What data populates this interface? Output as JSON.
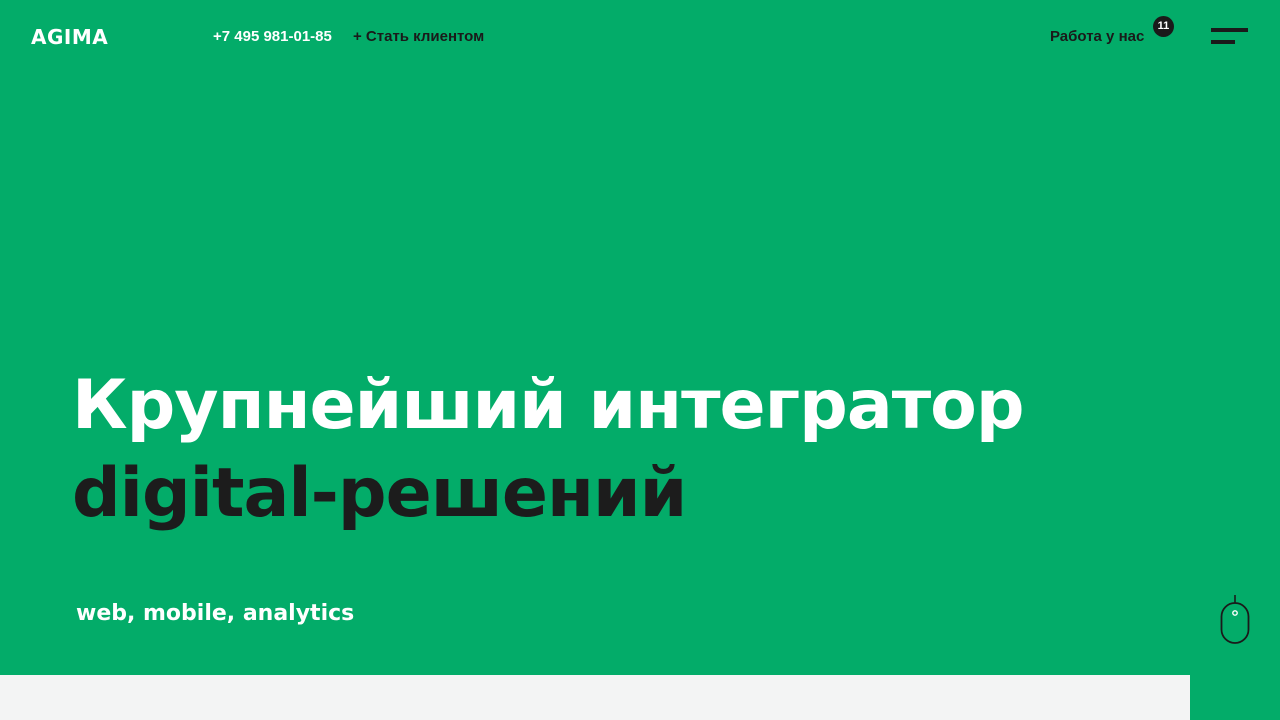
{
  "header": {
    "logo": "AGIMA",
    "phone": "+7 495 981-01-85",
    "become_client": "+ Стать клиентом",
    "careers": "Работа у нас",
    "careers_count": "11",
    "menu_icon": "hamburger-menu-icon"
  },
  "hero": {
    "title_line1": "Крупнейший интегратор",
    "title_line2": "digital-решений",
    "tagline": "web, mobile, analytics",
    "scroll_icon": "mouse-scroll-icon"
  },
  "colors": {
    "brand_green": "#03ac69",
    "dark": "#1a1a1a",
    "white": "#ffffff",
    "light_gray": "#f3f4f4"
  }
}
